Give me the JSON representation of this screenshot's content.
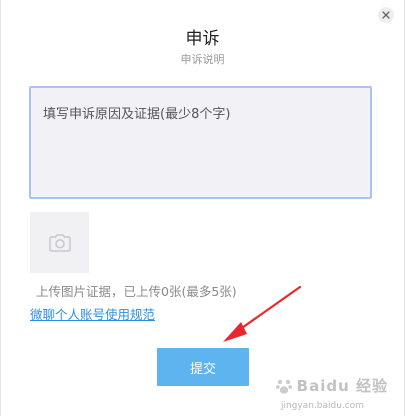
{
  "dialog": {
    "title": "申诉",
    "subtitle": "申诉说明",
    "close_icon": "close-icon"
  },
  "reason_input": {
    "placeholder": "填写申诉原因及证据(最少8个字)",
    "value": ""
  },
  "upload": {
    "icon": "camera-icon",
    "hint": "上传图片证据，已上传0张(最多5张)"
  },
  "rules_link": {
    "label": "微聊个人账号使用规范"
  },
  "submit_button": {
    "label": "提交"
  },
  "annotation": {
    "arrow_color": "#e8282c"
  },
  "watermark": {
    "text": "Baidu 经验",
    "sub": "jingyan.baidu.com"
  },
  "colors": {
    "accent": "#5db4ee",
    "link": "#2a8ee0",
    "input_border": "#a9c3f0"
  }
}
